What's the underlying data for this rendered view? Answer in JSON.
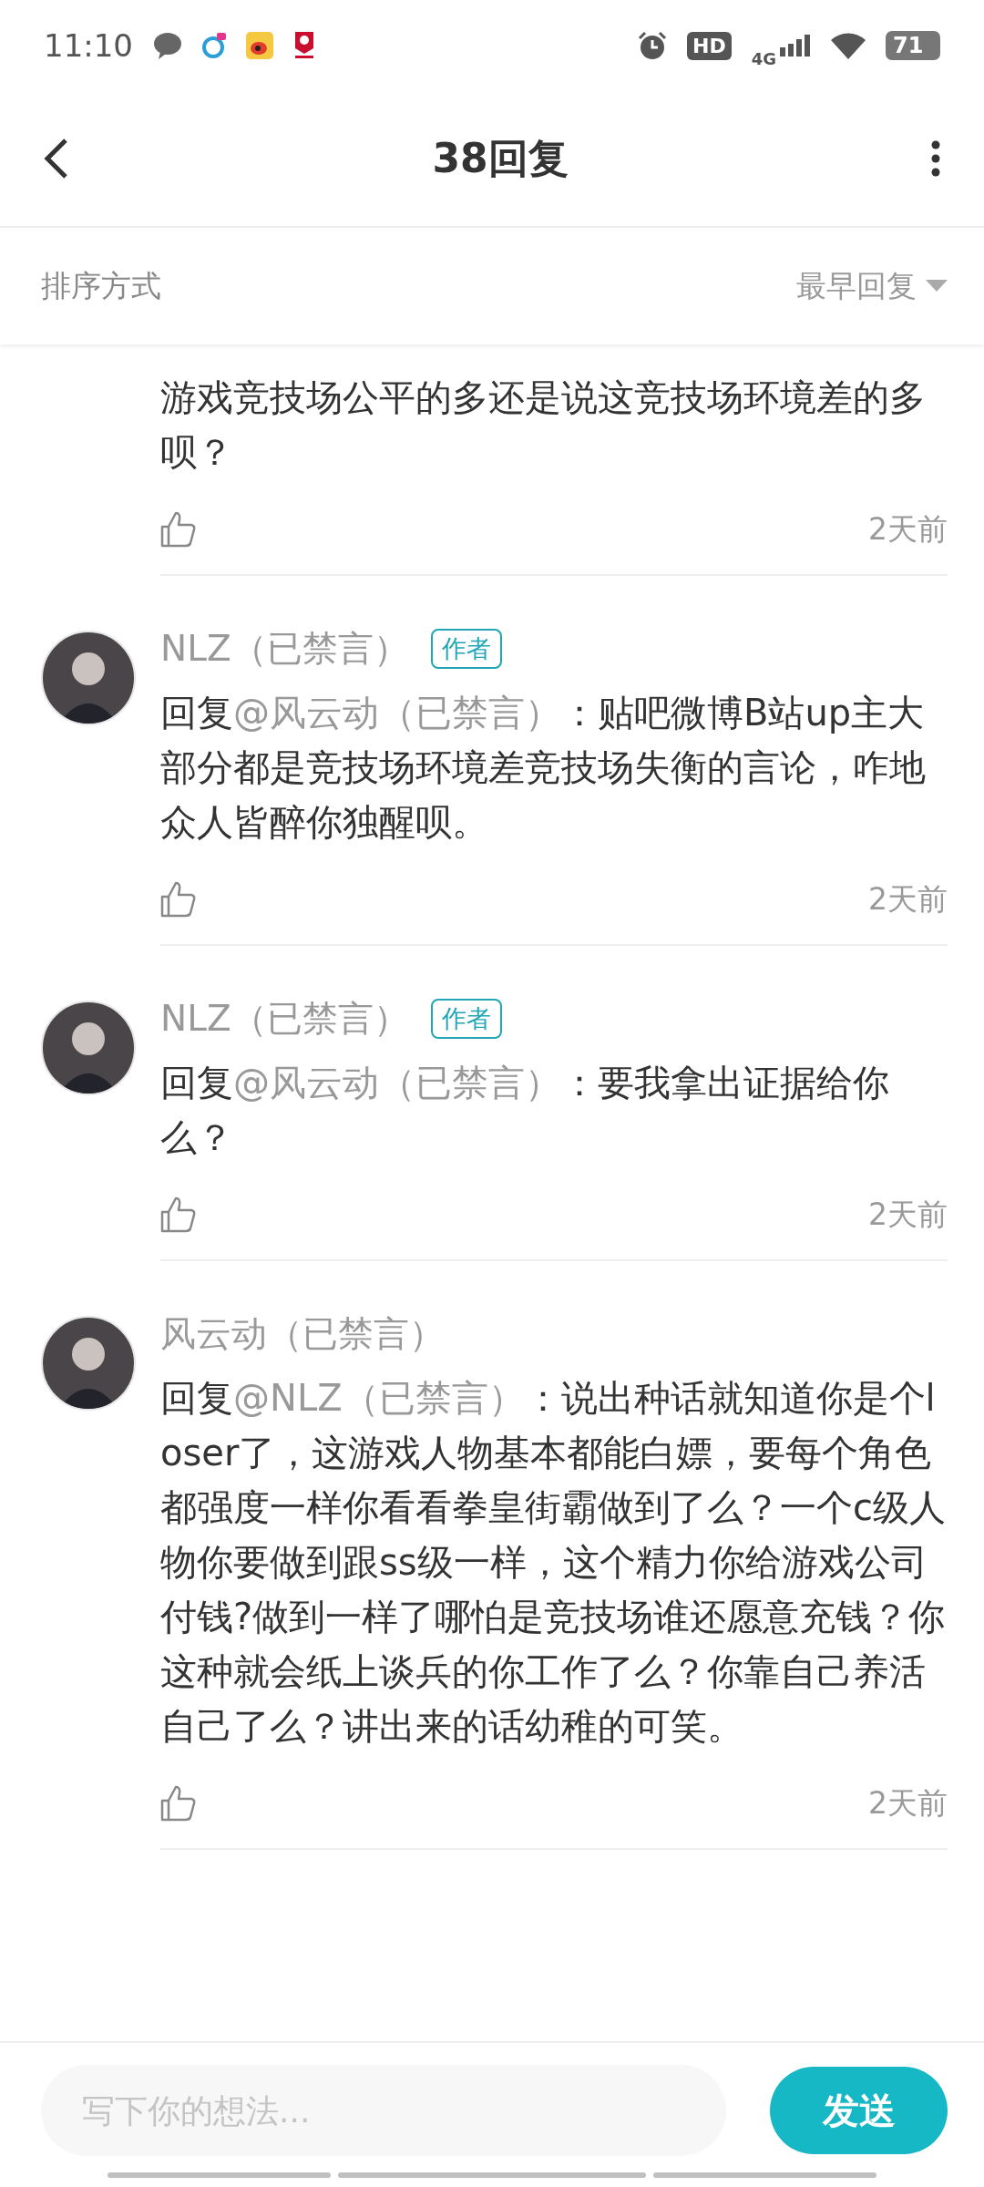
{
  "status_bar": {
    "time": "11:10",
    "hd": "HD",
    "network": "4G",
    "battery": "71"
  },
  "header": {
    "title": "38回复"
  },
  "sort": {
    "label": "排序方式",
    "value": "最早回复"
  },
  "comments": [
    {
      "kind": "continued",
      "body": "游戏竞技场公平的多还是说这竞技场环境差的多呗？",
      "time": "2天前"
    },
    {
      "kind": "full",
      "author": "NLZ（已禁言）",
      "badge": "作者",
      "reply_prefix": "回复",
      "mention": "@风云动（已禁言）",
      "body": "：贴吧微博B站up主大部分都是竞技场环境差竞技场失衡的言论，咋地众人皆醉你独醒呗。",
      "time": "2天前"
    },
    {
      "kind": "full",
      "author": "NLZ（已禁言）",
      "badge": "作者",
      "reply_prefix": "回复",
      "mention": "@风云动（已禁言）",
      "body": "：要我拿出证据给你么？",
      "time": "2天前"
    },
    {
      "kind": "full",
      "author": "风云动（已禁言）",
      "reply_prefix": "回复",
      "mention": "@NLZ（已禁言）",
      "body": "：说出种话就知道你是个loser了，这游戏人物基本都能白嫖，要每个角色都强度一样你看看拳皇街霸做到了么？一个c级人物你要做到跟ss级一样，这个精力你给游戏公司付钱?做到一样了哪怕是竞技场谁还愿意充钱？你这种就会纸上谈兵的你工作了么？你靠自己养活自己了么？讲出来的话幼稚的可笑。",
      "time": "2天前"
    }
  ],
  "reply_bar": {
    "placeholder": "写下你的想法...",
    "send": "发送"
  }
}
